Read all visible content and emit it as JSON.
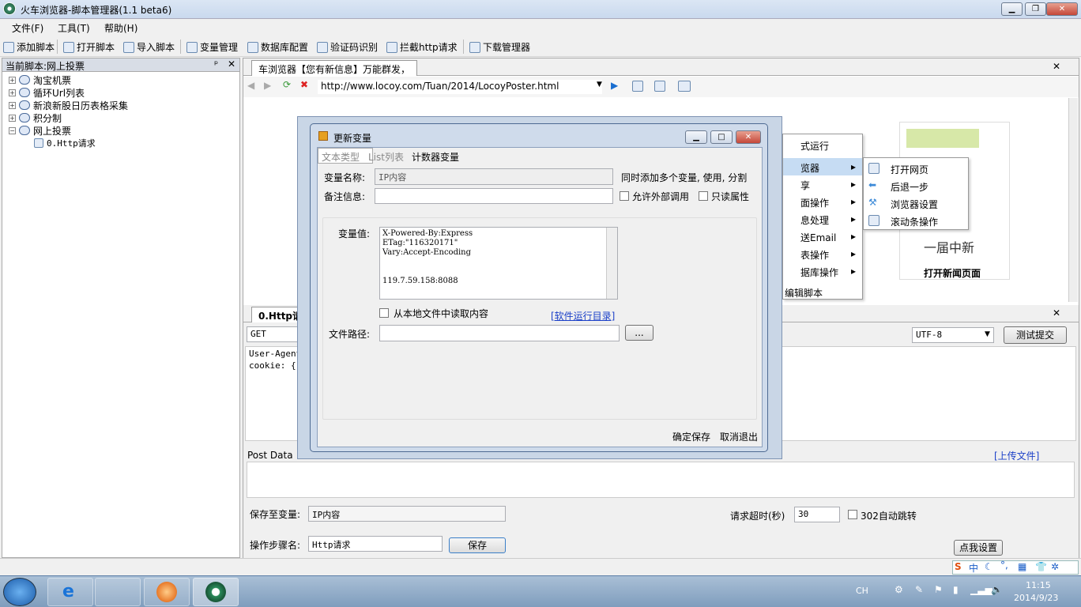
{
  "window": {
    "title": "火车浏览器-脚本管理器(1.1 beta6)"
  },
  "menu": [
    "文件(F)",
    "工具(T)",
    "帮助(H)"
  ],
  "toolbar": [
    "添加脚本",
    "打开脚本",
    "导入脚本",
    "变量管理",
    "数据库配置",
    "验证码识别",
    "拦截http请求",
    "下载管理器"
  ],
  "left": {
    "header": "当前脚本:网上投票",
    "pin": "ᵖ",
    "close": "✕",
    "tree": [
      "淘宝机票",
      "循环Url列表",
      "新浪新股日历表格采集",
      "积分制",
      "网上投票"
    ],
    "child": "0.Http请求"
  },
  "right": {
    "tab": "车浏览器【您有新信息】万能群发，",
    "tab_close": "✕",
    "url": "http://www.locoy.com/Tuan/2014/LocoyPoster.html"
  },
  "ctx1": {
    "items": [
      "式运行",
      "览器",
      "享",
      "面操作",
      "息处理",
      "送Email",
      "表操作",
      "据库操作",
      "编辑脚本"
    ],
    "arrow": "▸"
  },
  "ctx2": {
    "items": [
      "打开网页",
      "后退一步",
      "浏览器设置",
      "滚动条操作"
    ]
  },
  "news": {
    "title": "打开新闻页面",
    "glimpse": "一届中新"
  },
  "dialog": {
    "title": "更新变量",
    "tabs": [
      "文本类型",
      "List列表",
      "计数器变量"
    ],
    "name_label": "变量名称:",
    "name_value": "IP内容",
    "multi_hint": "同时添加多个变量, 使用, 分割",
    "note_label": "备注信息:",
    "note_value": "",
    "allow_external": "允许外部调用",
    "readonly": "只读属性",
    "value_label": "变量值:",
    "value_lines": [
      "X-Powered-By:Express",
      "ETag:\"116320171\"",
      "Vary:Accept-Encoding",
      "",
      "",
      "119.7.59.158:8088"
    ],
    "local_file": "从本地文件中读取内容",
    "run_dir": "[软件运行目录]",
    "path_label": "文件路径:",
    "path_value": "",
    "browse": "...",
    "ok": "确定保存",
    "cancel": "取消退出"
  },
  "bottom": {
    "tab": "0.Http请求",
    "method": "GET",
    "encoding": "UTF-8",
    "test": "测试提交",
    "headers": [
      "User-Agent",
      "cookie: {--"
    ],
    "post_data": "Post Data",
    "upload": "[上传文件]",
    "save_to": "保存至变量:",
    "save_var": "IP内容",
    "timeout_label": "请求超时(秒)",
    "timeout": "30",
    "redirect": "302自动跳转",
    "step_label": "操作步骤名:",
    "step_name": "Http请求",
    "save": "保存",
    "settings": "点我设置"
  },
  "tray": {
    "lang": "CH",
    "time": "11:15",
    "date": "2014/9/23",
    "ime": "中"
  }
}
